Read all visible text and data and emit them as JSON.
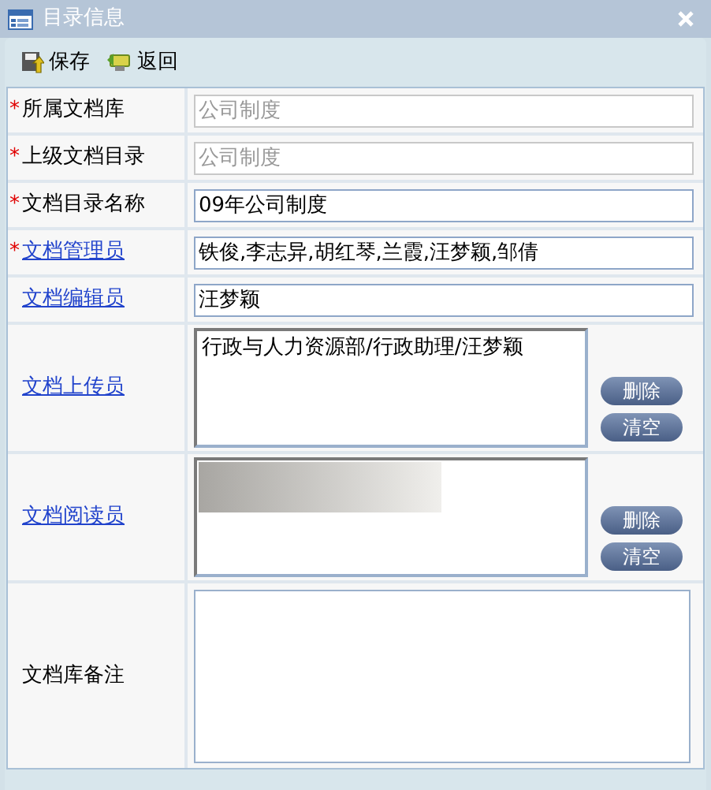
{
  "window": {
    "title": "目录信息"
  },
  "toolbar": [
    {
      "label": "保存",
      "kind": "save"
    },
    {
      "label": "返回",
      "kind": "back"
    }
  ],
  "rows": [
    {
      "kind": "text",
      "marker": "*",
      "label": "所属文档库",
      "link": false,
      "value": "公司制度",
      "disabled": true
    },
    {
      "kind": "text",
      "marker": "*",
      "label": "上级文档目录",
      "link": false,
      "value": "公司制度",
      "disabled": true
    },
    {
      "kind": "text",
      "marker": "*",
      "label": "文档目录名称",
      "link": false,
      "value": "09年公司制度",
      "disabled": false
    },
    {
      "kind": "text",
      "marker": "*",
      "label": "文档管理员",
      "link": true,
      "value": "铁俊,李志异,胡红琴,兰霞,汪梦颖,邹倩",
      "disabled": false
    },
    {
      "kind": "text",
      "label": "文档编辑员",
      "link": true,
      "value": "汪梦颖",
      "disabled": false
    },
    {
      "kind": "list",
      "label": "文档上传员",
      "link": true,
      "items": [
        "行政与人力资源部/行政助理/汪梦颖"
      ],
      "redacted": false,
      "buttons": [
        "删除",
        "清空"
      ]
    },
    {
      "kind": "list",
      "label": "文档阅读员",
      "link": true,
      "redacted": true,
      "buttons": [
        "删除",
        "清空"
      ]
    },
    {
      "kind": "textarea",
      "label": "文档库备注",
      "link": false
    }
  ]
}
